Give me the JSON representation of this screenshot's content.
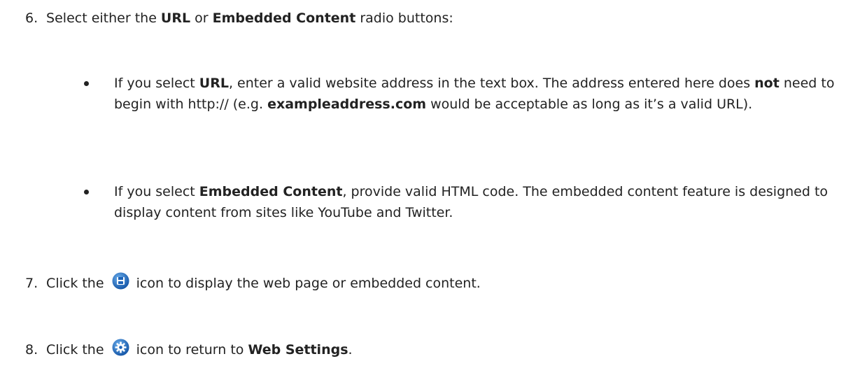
{
  "step6": {
    "number": "6.",
    "text_a": "Select either the ",
    "bold_url": "URL",
    "text_b": " or ",
    "bold_embedded": "Embedded Content",
    "text_c": " radio buttons:"
  },
  "bullet1": {
    "text_a": "If you select ",
    "bold_url": "URL",
    "text_b": ", enter a valid website address in the text box. The address entered here does ",
    "bold_not": "not",
    "text_c": " need to begin with http:// (e.g. ",
    "bold_example": "exampleaddress.com",
    "text_d": " would be acceptable as long as it’s a valid URL)."
  },
  "bullet2": {
    "text_a": "If you select ",
    "bold_embedded": "Embedded Content",
    "text_b": ", provide valid HTML code. The embedded content feature is designed to display content from sites like YouTube and Twitter."
  },
  "step7": {
    "number": "7.",
    "text_a": "Click the ",
    "icon": "save-icon",
    "text_b": " icon to display the web page or embedded content."
  },
  "step8": {
    "number": "8.",
    "text_a": "Click the ",
    "icon": "gear-icon",
    "text_b": " icon to return to ",
    "bold_settings": "Web Settings",
    "text_c": "."
  },
  "colors": {
    "text": "#222222",
    "icon_blue": "#1f6fc5"
  }
}
